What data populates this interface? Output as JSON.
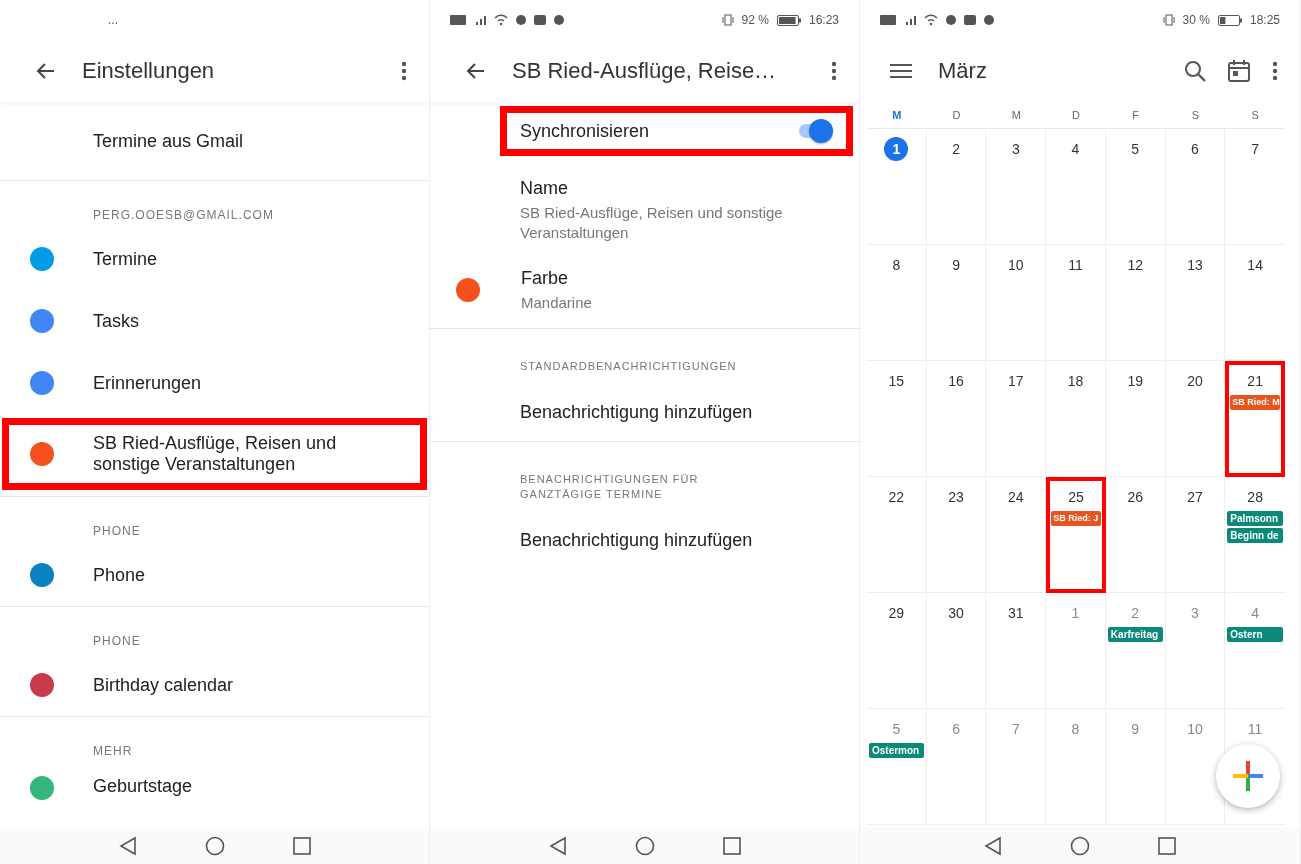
{
  "settings_screen": {
    "status_bar": {
      "text": "..."
    },
    "title": "Einstellungen",
    "items": [
      {
        "kind": "entry",
        "label": "Termine aus Gmail",
        "highlighted": false
      },
      {
        "kind": "section",
        "label": "PERG.OOESB@GMAIL.COM",
        "highlighted": false
      },
      {
        "kind": "calendar",
        "label": "Termine",
        "color": "#039be5",
        "highlighted": false
      },
      {
        "kind": "calendar",
        "label": "Tasks",
        "color": "#4285f4",
        "highlighted": false
      },
      {
        "kind": "calendar",
        "label": "Erinnerungen",
        "color": "#4285f4",
        "highlighted": false
      },
      {
        "kind": "calendar",
        "label": "SB Ried-Ausflüge, Reisen und sonstige Veranstaltungen",
        "color": "#f4511e",
        "highlighted": true
      },
      {
        "kind": "section",
        "label": "PHONE",
        "highlighted": false
      },
      {
        "kind": "calendar",
        "label": "Phone",
        "color": "#0b80c3",
        "highlighted": false
      },
      {
        "kind": "section",
        "label": "PHONE",
        "highlighted": false
      },
      {
        "kind": "calendar",
        "label": "Birthday calendar",
        "color": "#c93a4d",
        "highlighted": false
      },
      {
        "kind": "section",
        "label": "MEHR",
        "highlighted": false
      },
      {
        "kind": "calendar",
        "label": "Geburtstage",
        "color": "#33b679",
        "highlighted": false
      }
    ]
  },
  "calendar_settings_screen": {
    "status_bar": {
      "battery": "92 %",
      "time": "16:23"
    },
    "title": "SB Ried-Ausflüge, Reise…",
    "sync": {
      "label": "Synchronisieren",
      "on": true,
      "highlighted": true
    },
    "name": {
      "label": "Name",
      "value": "SB Ried-Ausflüge, Reisen und sonstige Veranstaltungen"
    },
    "color": {
      "label": "Farbe",
      "value": "Mandarine",
      "color": "#f4511e"
    },
    "sections": [
      {
        "heading": "STANDARDBENACHRICHTIGUNGEN",
        "action": "Benachrichtigung hinzufügen"
      },
      {
        "heading": "BENACHRICHTIGUNGEN FÜR GANZTÄGIGE TERMINE",
        "action": "Benachrichtigung hinzufügen"
      }
    ]
  },
  "month_screen": {
    "status_bar": {
      "battery": "30 %",
      "time": "18:25"
    },
    "title": "März",
    "weekdays": [
      {
        "label": "M",
        "current": true
      },
      {
        "label": "D",
        "current": false
      },
      {
        "label": "M",
        "current": false
      },
      {
        "label": "D",
        "current": false
      },
      {
        "label": "F",
        "current": false
      },
      {
        "label": "S",
        "current": false
      },
      {
        "label": "S",
        "current": false
      }
    ],
    "days": [
      {
        "day": "1",
        "today": true,
        "other_month": false,
        "highlighted": false
      },
      {
        "day": "2",
        "today": false,
        "other_month": false,
        "highlighted": false
      },
      {
        "day": "3",
        "today": false,
        "other_month": false,
        "highlighted": false
      },
      {
        "day": "4",
        "today": false,
        "other_month": false,
        "highlighted": false
      },
      {
        "day": "5",
        "today": false,
        "other_month": false,
        "highlighted": false
      },
      {
        "day": "6",
        "today": false,
        "other_month": false,
        "highlighted": false
      },
      {
        "day": "7",
        "today": false,
        "other_month": false,
        "highlighted": false
      },
      {
        "day": "8",
        "today": false,
        "other_month": false,
        "highlighted": false
      },
      {
        "day": "9",
        "today": false,
        "other_month": false,
        "highlighted": false
      },
      {
        "day": "10",
        "today": false,
        "other_month": false,
        "highlighted": false
      },
      {
        "day": "11",
        "today": false,
        "other_month": false,
        "highlighted": false
      },
      {
        "day": "12",
        "today": false,
        "other_month": false,
        "highlighted": false
      },
      {
        "day": "13",
        "today": false,
        "other_month": false,
        "highlighted": false
      },
      {
        "day": "14",
        "today": false,
        "other_month": false,
        "highlighted": false
      },
      {
        "day": "15",
        "today": false,
        "other_month": false,
        "highlighted": false
      },
      {
        "day": "16",
        "today": false,
        "other_month": false,
        "highlighted": false
      },
      {
        "day": "17",
        "today": false,
        "other_month": false,
        "highlighted": false
      },
      {
        "day": "18",
        "today": false,
        "other_month": false,
        "highlighted": false
      },
      {
        "day": "19",
        "today": false,
        "other_month": false,
        "highlighted": false
      },
      {
        "day": "20",
        "today": false,
        "other_month": false,
        "highlighted": false
      },
      {
        "day": "21",
        "today": false,
        "other_month": false,
        "highlighted": true,
        "events": [
          {
            "title": "SB Ried: M",
            "color": "#e8541e"
          }
        ]
      },
      {
        "day": "22",
        "today": false,
        "other_month": false,
        "highlighted": false
      },
      {
        "day": "23",
        "today": false,
        "other_month": false,
        "highlighted": false
      },
      {
        "day": "24",
        "today": false,
        "other_month": false,
        "highlighted": false
      },
      {
        "day": "25",
        "today": false,
        "other_month": false,
        "highlighted": true,
        "events": [
          {
            "title": "SB Ried: J",
            "color": "#e8541e"
          }
        ]
      },
      {
        "day": "26",
        "today": false,
        "other_month": false,
        "highlighted": false
      },
      {
        "day": "27",
        "today": false,
        "other_month": false,
        "highlighted": false
      },
      {
        "day": "28",
        "today": false,
        "other_month": false,
        "highlighted": false,
        "events": [
          {
            "title": "Palmsonn",
            "color": "#0b8a7a"
          },
          {
            "title": "Beginn de",
            "color": "#0b8a7a"
          }
        ]
      },
      {
        "day": "29",
        "today": false,
        "other_month": false,
        "highlighted": false
      },
      {
        "day": "30",
        "today": false,
        "other_month": false,
        "highlighted": false
      },
      {
        "day": "31",
        "today": false,
        "other_month": false,
        "highlighted": false
      },
      {
        "day": "1",
        "today": false,
        "other_month": true,
        "highlighted": false
      },
      {
        "day": "2",
        "today": false,
        "other_month": true,
        "highlighted": false,
        "events": [
          {
            "title": "Karfreitag",
            "color": "#0b8a7a"
          }
        ]
      },
      {
        "day": "3",
        "today": false,
        "other_month": true,
        "highlighted": false
      },
      {
        "day": "4",
        "today": false,
        "other_month": true,
        "highlighted": false,
        "events": [
          {
            "title": "Ostern",
            "color": "#0b8a7a"
          }
        ]
      },
      {
        "day": "5",
        "today": false,
        "other_month": true,
        "highlighted": false,
        "events": [
          {
            "title": "Ostermon",
            "color": "#0b8a7a"
          }
        ]
      },
      {
        "day": "6",
        "today": false,
        "other_month": true,
        "highlighted": false
      },
      {
        "day": "7",
        "today": false,
        "other_month": true,
        "highlighted": false
      },
      {
        "day": "8",
        "today": false,
        "other_month": true,
        "highlighted": false
      },
      {
        "day": "9",
        "today": false,
        "other_month": true,
        "highlighted": false
      },
      {
        "day": "10",
        "today": false,
        "other_month": true,
        "highlighted": false
      },
      {
        "day": "11",
        "today": false,
        "other_month": true,
        "highlighted": false
      }
    ]
  }
}
